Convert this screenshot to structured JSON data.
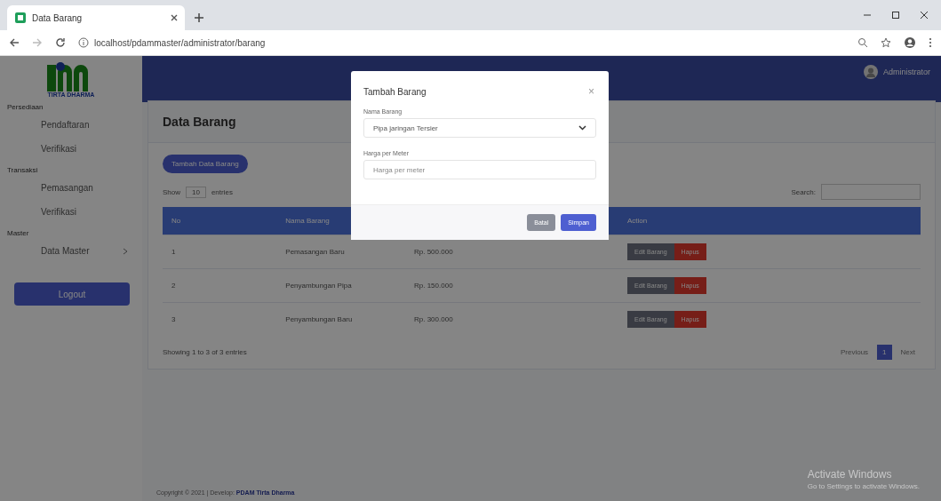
{
  "browser": {
    "tab_title": "Data Barang",
    "url": "localhost/pdammaster/administrator/barang"
  },
  "sidebar": {
    "logo_text": "TIRTA DHARMA",
    "sections": [
      {
        "heading": "Persediaan",
        "items": [
          {
            "label": "Pendaftaran",
            "expandable": false
          },
          {
            "label": "Verifikasi",
            "expandable": false
          }
        ]
      },
      {
        "heading": "Transaksi",
        "items": [
          {
            "label": "Pemasangan",
            "expandable": false
          },
          {
            "label": "Verifikasi",
            "expandable": false
          }
        ]
      },
      {
        "heading": "Master",
        "items": [
          {
            "label": "Data Master",
            "expandable": true
          }
        ]
      }
    ],
    "logout": "Logout"
  },
  "topbar": {
    "user": "Administrator"
  },
  "page": {
    "title": "Data Barang",
    "add_button": "Tambah Data Barang",
    "show": "Show",
    "entries_count": "10",
    "entries": "entries",
    "search_label": "Search:",
    "table": {
      "columns": [
        "No",
        "Nama Barang",
        "Action"
      ],
      "rows": [
        {
          "no": "1",
          "name": "Pemasangan Baru",
          "price": "Rp. 500.000",
          "edit": "Edit Barang",
          "delete": "Hapus"
        },
        {
          "no": "2",
          "name": "Penyambungan Pipa",
          "price": "Rp. 150.000",
          "edit": "Edit Barang",
          "delete": "Hapus"
        },
        {
          "no": "3",
          "name": "Penyambungan Baru",
          "price": "Rp. 300.000",
          "edit": "Edit Barang",
          "delete": "Hapus"
        }
      ]
    },
    "info": "Showing 1 to 3 of 3 entries",
    "pagination": [
      {
        "label": "Previous",
        "selected": false
      },
      {
        "label": "1",
        "selected": true
      },
      {
        "label": "Next",
        "selected": false
      }
    ]
  },
  "footer": {
    "text": "Copyright © 2021 | Develop:",
    "link": "PDAM Tirta Dharma"
  },
  "activation": {
    "title": "Activate Windows",
    "text": "Go to Settings to activate Windows."
  },
  "modal": {
    "title": "Tambah Barang",
    "close": "×",
    "fields": [
      {
        "kind": "select",
        "label": "Nama Barang",
        "value": "Pipa jaringan Tersier"
      },
      {
        "kind": "input",
        "label": "Harga per Meter",
        "placeholder": "Harga per meter"
      }
    ],
    "buttons": [
      {
        "label": "Batal",
        "kind": "secondary"
      },
      {
        "label": "Simpan",
        "kind": "primary"
      }
    ]
  }
}
